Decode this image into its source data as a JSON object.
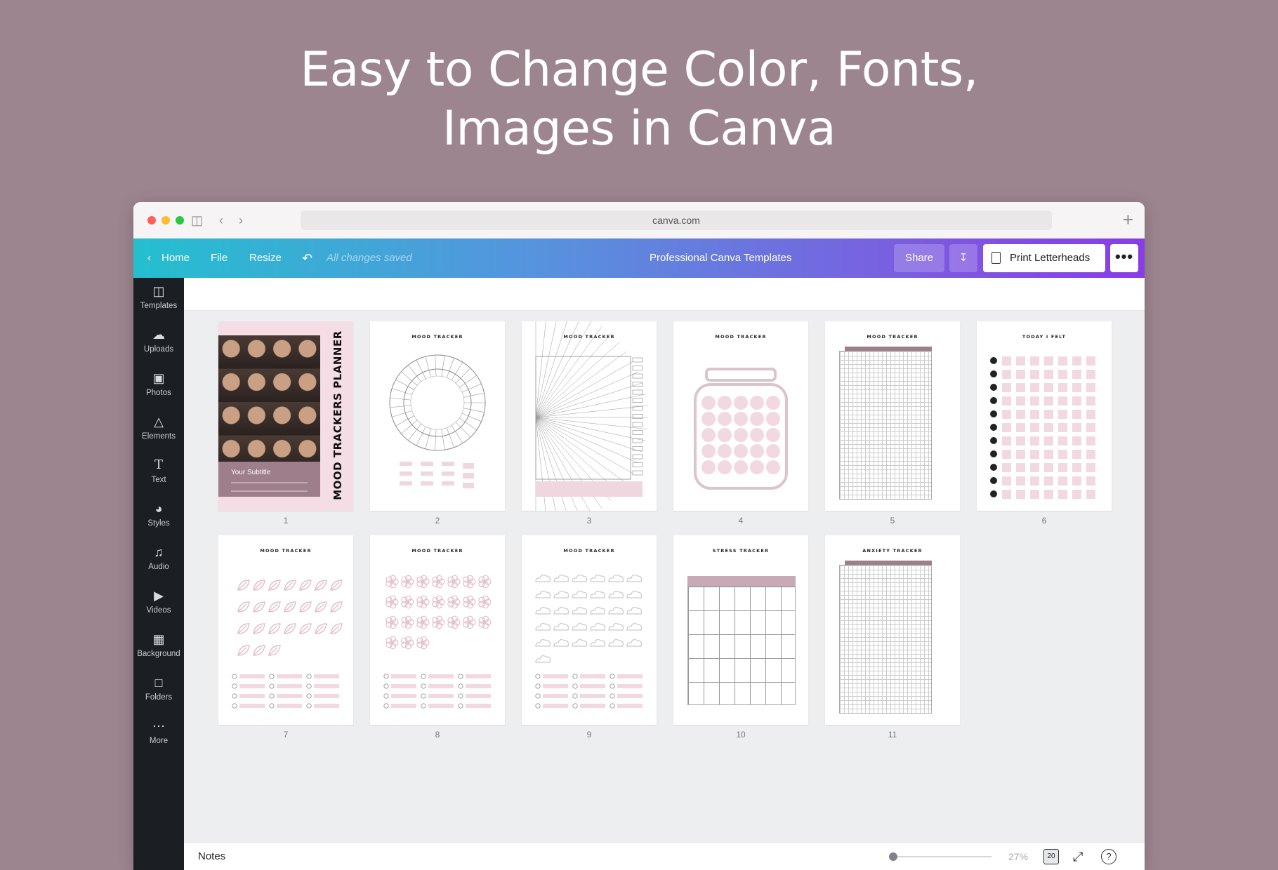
{
  "headline": {
    "line1": "Easy to Change Color, Fonts,",
    "line2": "Images in Canva"
  },
  "browser": {
    "url": "canva.com"
  },
  "toolbar": {
    "home": "Home",
    "file": "File",
    "resize": "Resize",
    "status": "All changes saved",
    "project_title": "Professional Canva Templates",
    "share": "Share",
    "print": "Print Letterheads",
    "more": "•••"
  },
  "sidebar": {
    "items": [
      {
        "label": "Templates",
        "icon": "templates-icon"
      },
      {
        "label": "Uploads",
        "icon": "upload-cloud-icon"
      },
      {
        "label": "Photos",
        "icon": "photo-icon"
      },
      {
        "label": "Elements",
        "icon": "shapes-icon"
      },
      {
        "label": "Text",
        "icon": "text-t-icon"
      },
      {
        "label": "Styles",
        "icon": "palette-icon"
      },
      {
        "label": "Audio",
        "icon": "music-note-icon"
      },
      {
        "label": "Videos",
        "icon": "video-icon"
      },
      {
        "label": "Background",
        "icon": "background-hatch-icon"
      },
      {
        "label": "Folders",
        "icon": "folder-icon"
      },
      {
        "label": "More",
        "icon": "dots-icon"
      }
    ]
  },
  "pages": [
    {
      "number": "1",
      "title": "MOOD TRACKERS PLANNER",
      "subtitle": "Your Subtitle"
    },
    {
      "number": "2",
      "title": "MOOD TRACKER"
    },
    {
      "number": "3",
      "title": "MOOD TRACKER"
    },
    {
      "number": "4",
      "title": "MOOD TRACKER"
    },
    {
      "number": "5",
      "title": "MOOD TRACKER"
    },
    {
      "number": "6",
      "title": "TODAY I FELT"
    },
    {
      "number": "7",
      "title": "MOOD TRACKER"
    },
    {
      "number": "8",
      "title": "MOOD TRACKER"
    },
    {
      "number": "9",
      "title": "MOOD TRACKER"
    },
    {
      "number": "10",
      "title": "STRESS TRACKER"
    },
    {
      "number": "11",
      "title": "ANXIETY TRACKER"
    }
  ],
  "bottombar": {
    "notes": "Notes",
    "zoom": "27%",
    "page_count": "20",
    "help": "?"
  },
  "colors": {
    "accent_start": "#24bfcf",
    "accent_end": "#8a3ce6",
    "pink": "#f0d7df",
    "mauve": "#9d7e8a"
  }
}
